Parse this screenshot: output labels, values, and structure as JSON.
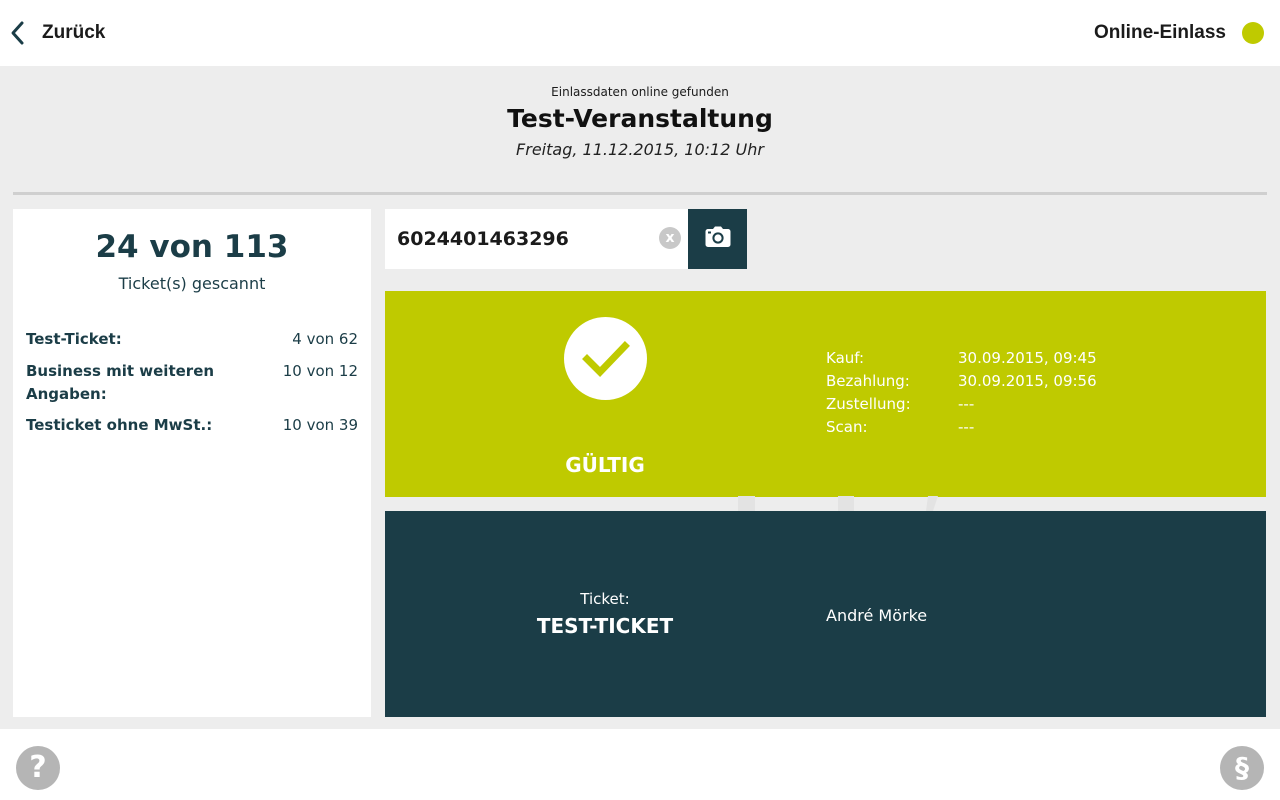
{
  "colors": {
    "accent": "#bfca00",
    "dark": "#1b3d47",
    "background": "#ededed"
  },
  "header": {
    "back_label": "Zurück",
    "back_icon": "chevron-left-icon",
    "mode_label": "Online-Einlass",
    "status_icon": "status-dot-icon"
  },
  "event": {
    "status_text": "Einlassdaten online gefunden",
    "title": "Test-Veranstaltung",
    "datetime": "Freitag, 11.12.2015, 10:12 Uhr"
  },
  "stats": {
    "total": "24 von 113",
    "caption": "Ticket(s) gescannt",
    "rows": [
      {
        "name": "Test-Ticket:",
        "value": "4 von 62"
      },
      {
        "name": "Business mit weiteren Angaben:",
        "value": "10 von 12"
      },
      {
        "name": "Testicket ohne MwSt.:",
        "value": "10 von 39"
      }
    ]
  },
  "scan": {
    "code": "6024401463296",
    "clear_icon": "clear-icon",
    "clear_glyph": "x",
    "camera_icon": "camera-icon"
  },
  "result": {
    "status": "GÜLTIG",
    "icon": "checkmark-icon",
    "details": [
      {
        "key": "Kauf:",
        "value": "30.09.2015, 09:45"
      },
      {
        "key": "Bezahlung:",
        "value": "30.09.2015, 09:56"
      },
      {
        "key": "Zustellung:",
        "value": "---"
      },
      {
        "key": "Scan:",
        "value": "---"
      }
    ]
  },
  "ticket": {
    "label": "Ticket:",
    "type": "TEST-TICKET",
    "holder": "André Mörke"
  },
  "footer": {
    "help_glyph": "?",
    "help_icon": "help-icon",
    "legal_glyph": "§",
    "legal_icon": "legal-icon"
  }
}
